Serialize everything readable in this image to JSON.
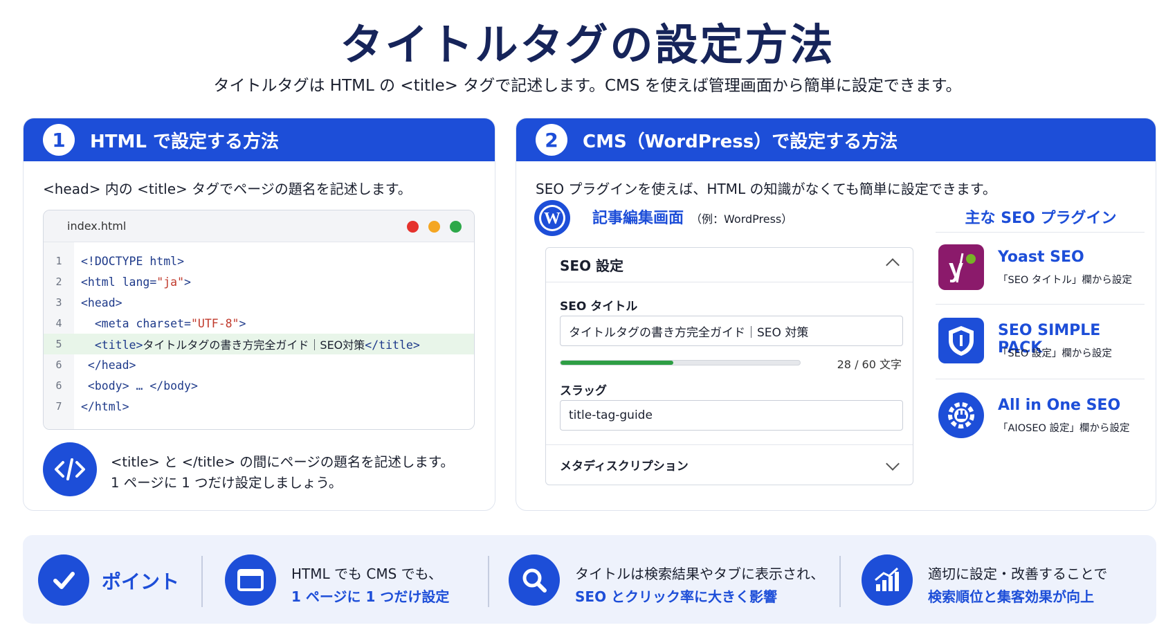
{
  "header": {
    "title": "タイトルタグの設定方法",
    "subtitle": "タイトルタグは HTML の <title> タグで記述します。CMS を使えば管理画面から簡単に設定できます。"
  },
  "panel_html": {
    "number": "1",
    "title": "HTML で設定する方法",
    "description": "<head> 内の <title> タグでページの題名を記述します。",
    "filename": "index.html",
    "window_dots": [
      "#e5322d",
      "#f4a623",
      "#2ea84a"
    ],
    "code_lines": [
      {
        "num": "1",
        "pre": "<!DOCTYPE html>",
        "str": "",
        "post": "",
        "jp": "",
        "tail": ""
      },
      {
        "num": "2",
        "pre": "<html lang=",
        "str": "\"ja\"",
        "post": ">",
        "jp": "",
        "tail": ""
      },
      {
        "num": "3",
        "pre": "<head>",
        "str": "",
        "post": "",
        "jp": "",
        "tail": ""
      },
      {
        "num": "4",
        "pre": "  <meta charset=",
        "str": "\"UTF-8\"",
        "post": ">",
        "jp": "",
        "tail": ""
      },
      {
        "num": "5",
        "pre": "  <title>",
        "str": "",
        "post": "",
        "jp": "タイトルタグの書き方完全ガイド｜SEO対策",
        "tail": "</title>"
      },
      {
        "num": "6",
        "pre": " </head>",
        "str": "",
        "post": "",
        "jp": "",
        "tail": ""
      },
      {
        "num": "6",
        "pre": " <body> … </body>",
        "str": "",
        "post": "",
        "jp": "",
        "tail": ""
      },
      {
        "num": "7",
        "pre": "</html>",
        "str": "",
        "post": "",
        "jp": "",
        "tail": ""
      }
    ],
    "note_line1": "<title> と </title> の間にページの題名を記述します。",
    "note_line2": "1 ページに 1 つだけ設定しましょう。"
  },
  "panel_cms": {
    "number": "2",
    "title": "CMS（WordPress）で設定する方法",
    "description": "SEO プラグインを使えば、HTML の知識がなくても簡単に設定できます。",
    "editor_label": "記事編集画面",
    "editor_example": "（例：WordPress）",
    "seo_box": {
      "heading": "SEO 設定",
      "title_label": "SEO タイトル",
      "title_value": "タイトルタグの書き方完全ガイド｜SEO 対策",
      "title_progress": 0.47,
      "title_count": "28 / 60 文字",
      "slug_label": "スラッグ",
      "slug_value": "title-tag-guide",
      "meta_label": "メタディスクリプション"
    },
    "plugins_title": "主な SEO プラグイン",
    "plugins": [
      {
        "name": "Yoast SEO",
        "sub": "「SEO タイトル」欄から設定",
        "icon": "yoast-icon",
        "color": "#8b1a6b"
      },
      {
        "name": "SEO SIMPLE PACK",
        "sub": "「SEO 設定」欄から設定",
        "icon": "shield-icon",
        "color": "#1d4ed8"
      },
      {
        "name": "All in One SEO",
        "sub": "「AIOSEO 設定」欄から設定",
        "icon": "gear-plug-icon",
        "color": "#1d4ed8"
      }
    ]
  },
  "points": {
    "label": "ポイント",
    "items": [
      {
        "line1": "HTML でも CMS でも、",
        "line2": "1 ページに 1 つだけ設定",
        "icon": "browser-window-icon"
      },
      {
        "line1": "タイトルは検索結果やタブに表示され、",
        "line2": "SEO とクリック率に大きく影響",
        "icon": "search-icon"
      },
      {
        "line1": "適切に設定・改善することで",
        "line2": "検索順位と集客効果が向上",
        "icon": "growth-chart-icon"
      }
    ]
  },
  "colors": {
    "primary": "#1d4ed8",
    "title": "#16245a",
    "progress": "#2e9e44"
  }
}
